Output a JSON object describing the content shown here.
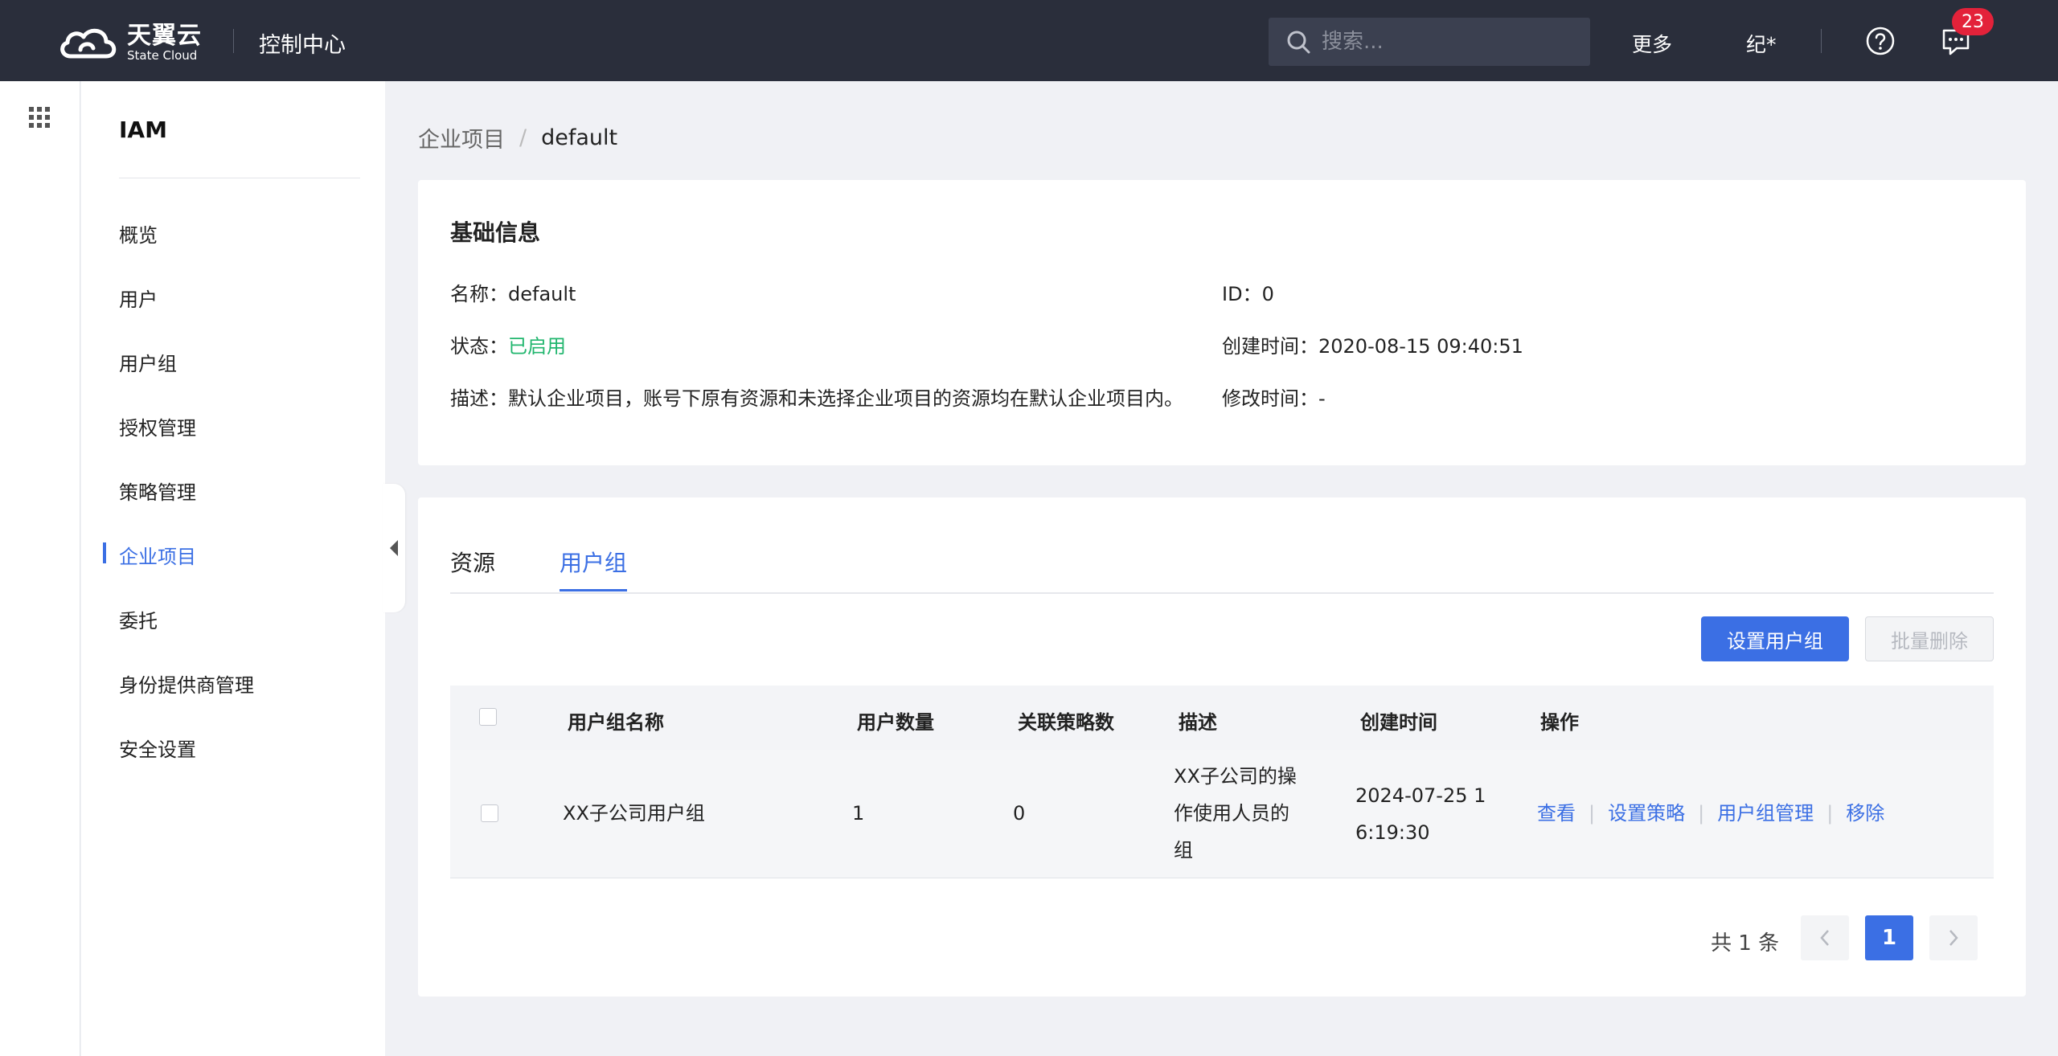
{
  "header": {
    "brand_cn": "天翼云",
    "brand_en": "State Cloud",
    "console_title": "控制中心",
    "search_placeholder": "搜索...",
    "more_label": "更多",
    "user_label": "纪*",
    "notification_count": "23"
  },
  "sidebar": {
    "title": "IAM",
    "items": [
      {
        "label": "概览"
      },
      {
        "label": "用户"
      },
      {
        "label": "用户组"
      },
      {
        "label": "授权管理"
      },
      {
        "label": "策略管理"
      },
      {
        "label": "企业项目",
        "active": true
      },
      {
        "label": "委托"
      },
      {
        "label": "身份提供商管理"
      },
      {
        "label": "安全设置"
      }
    ]
  },
  "breadcrumb": {
    "parent": "企业项目",
    "separator": "/",
    "current": "default"
  },
  "basic_info": {
    "title": "基础信息",
    "name_label": "名称：",
    "name_value": "default",
    "status_label": "状态：",
    "status_value": "已启用",
    "desc_label": "描述：",
    "desc_value": "默认企业项目，账号下原有资源和未选择企业项目的资源均在默认企业项目内。",
    "id_label": "ID：",
    "id_value": "0",
    "created_label": "创建时间：",
    "created_value": "2020-08-15 09:40:51",
    "modified_label": "修改时间：",
    "modified_value": "-"
  },
  "tabs": [
    {
      "label": "资源"
    },
    {
      "label": "用户组",
      "active": true
    }
  ],
  "toolbar": {
    "set_group_label": "设置用户组",
    "batch_delete_label": "批量删除"
  },
  "table": {
    "columns": [
      "用户组名称",
      "用户数量",
      "关联策略数",
      "描述",
      "创建时间",
      "操作"
    ],
    "rows": [
      {
        "name": "XX子公司用户组",
        "user_count": "1",
        "policy_count": "0",
        "desc_line1": "XX子公司的操",
        "desc_line2": "作使用人员的",
        "desc_line3": "组",
        "created_line1": "2024-07-25 1",
        "created_line2": "6:19:30",
        "actions": [
          "查看",
          "设置策略",
          "用户组管理",
          "移除"
        ]
      }
    ]
  },
  "pagination": {
    "total_text": "共 1 条",
    "current_page": "1",
    "prev_icon": "chevron-left-icon",
    "next_icon": "chevron-right-icon"
  },
  "colors": {
    "topbar": "#2a2e3b",
    "accent": "#3b6fe4",
    "success": "#21b66e",
    "badge": "#e3223a"
  }
}
